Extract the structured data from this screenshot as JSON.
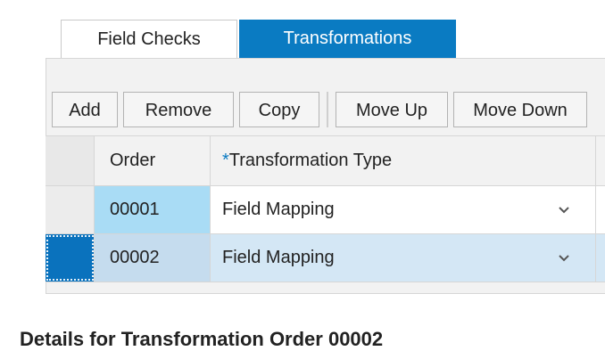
{
  "tabs": [
    {
      "label": "Field Checks",
      "active": false
    },
    {
      "label": "Transformations",
      "active": true
    }
  ],
  "toolbar": {
    "add": "Add",
    "remove": "Remove",
    "copy": "Copy",
    "move_up": "Move Up",
    "move_down": "Move Down"
  },
  "table": {
    "columns": [
      "Order",
      "Transformation Type"
    ],
    "required_marker": "*",
    "rows": [
      {
        "order": "00001",
        "type": "Field Mapping",
        "selected": false
      },
      {
        "order": "00002",
        "type": "Field Mapping",
        "selected": true
      }
    ]
  },
  "details_heading": "Details for Transformation Order 00002",
  "icons": {
    "dropdown": "chevron-down-icon"
  },
  "colors": {
    "accent": "#0a7bc2",
    "selected_row": "#d4e7f5",
    "order_highlight": "#a9dcf5"
  }
}
